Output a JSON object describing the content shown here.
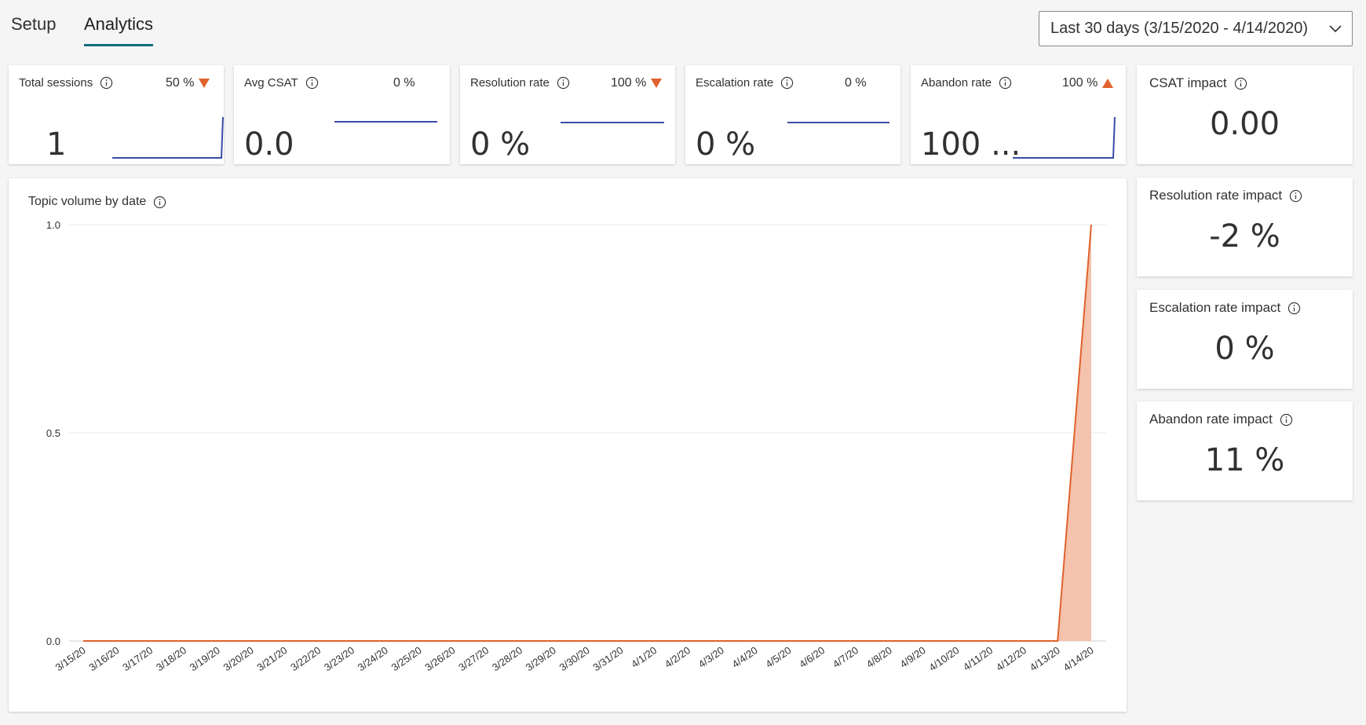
{
  "tabs": [
    {
      "label": "Setup",
      "active": false
    },
    {
      "label": "Analytics",
      "active": true
    }
  ],
  "date_filter": {
    "label": "Last 30 days (3/15/2020 - 4/14/2020)",
    "icon": "chevron-down-icon"
  },
  "kpis": [
    {
      "title": "Total sessions",
      "delta": "50 %",
      "trend": "down",
      "value": "1",
      "spark": "spike-up"
    },
    {
      "title": "Avg CSAT",
      "delta": "0 %",
      "trend": "none",
      "value": "0.0",
      "spark": "flat"
    },
    {
      "title": "Resolution rate",
      "delta": "100 %",
      "trend": "down",
      "value": "0 %",
      "spark": "flat"
    },
    {
      "title": "Escalation rate",
      "delta": "0 %",
      "trend": "none",
      "value": "0 %",
      "spark": "flat"
    },
    {
      "title": "Abandon rate",
      "delta": "100 %",
      "trend": "up",
      "value": "100 ...",
      "spark": "spike-up"
    }
  ],
  "impacts": [
    {
      "title": "CSAT impact",
      "value": "0.00"
    },
    {
      "title": "Resolution rate impact",
      "value": "-2 %"
    },
    {
      "title": "Escalation rate impact",
      "value": "0 %"
    },
    {
      "title": "Abandon rate impact",
      "value": "11 %"
    }
  ],
  "colors": {
    "accent_tab": "#0f6f7f",
    "spark_line": "#3b4ba8",
    "trend_arrow": "#e0622c",
    "area_line": "#e0622c",
    "area_fill": "#f4c2ad"
  },
  "chart": {
    "title": "Topic volume by date"
  },
  "chart_data": {
    "type": "area",
    "title": "Topic volume by date",
    "x": [
      "3/15/20",
      "3/16/20",
      "3/17/20",
      "3/18/20",
      "3/19/20",
      "3/20/20",
      "3/21/20",
      "3/22/20",
      "3/23/20",
      "3/24/20",
      "3/25/20",
      "3/26/20",
      "3/27/20",
      "3/28/20",
      "3/29/20",
      "3/30/20",
      "3/31/20",
      "4/1/20",
      "4/2/20",
      "4/3/20",
      "4/4/20",
      "4/5/20",
      "4/6/20",
      "4/7/20",
      "4/8/20",
      "4/9/20",
      "4/10/20",
      "4/11/20",
      "4/12/20",
      "4/13/20",
      "4/14/20"
    ],
    "series": [
      {
        "values": [
          0,
          0,
          0,
          0,
          0,
          0,
          0,
          0,
          0,
          0,
          0,
          0,
          0,
          0,
          0,
          0,
          0,
          0,
          0,
          0,
          0,
          0,
          0,
          0,
          0,
          0,
          0,
          0,
          0,
          0,
          1
        ]
      }
    ],
    "yticks": [
      "0.0",
      "0.5",
      "1.0"
    ],
    "ylim": [
      0,
      1
    ],
    "grid": true
  }
}
